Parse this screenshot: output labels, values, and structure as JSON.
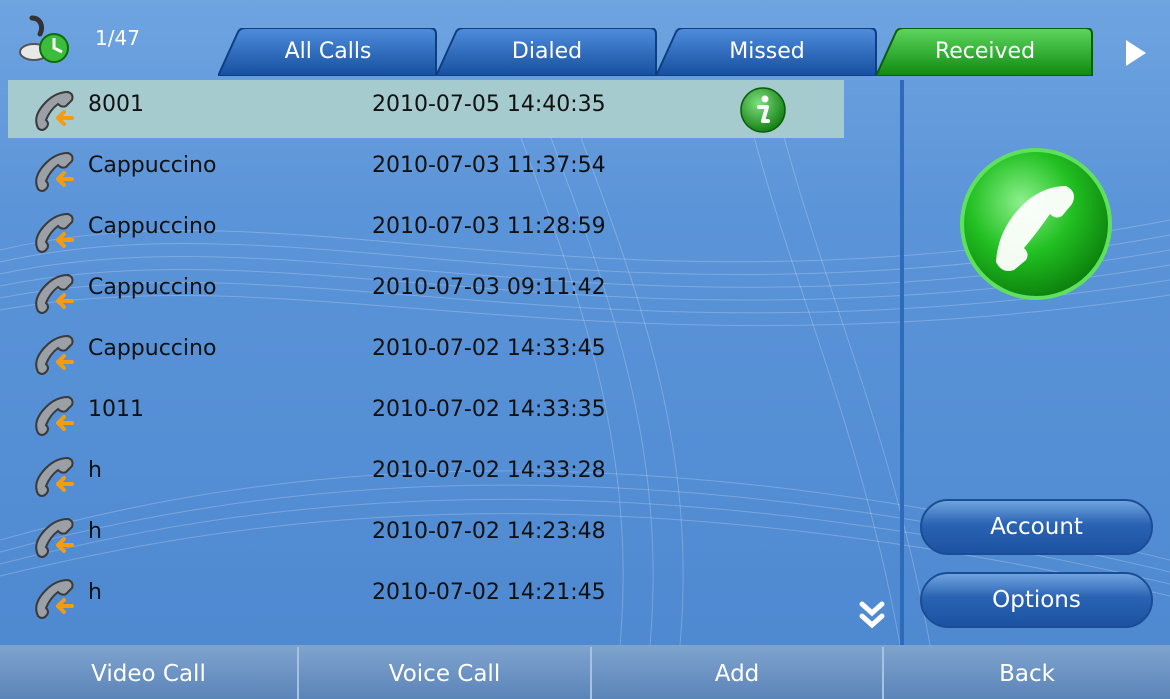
{
  "header": {
    "counter": "1/47",
    "tabs": [
      {
        "label": "All Calls",
        "active": false
      },
      {
        "label": "Dialed",
        "active": false
      },
      {
        "label": "Missed",
        "active": false
      },
      {
        "label": "Received",
        "active": true
      }
    ],
    "logo_icon": "phone-clock-icon",
    "next_icon": "triangle-right-icon"
  },
  "calls": [
    {
      "name": "8001",
      "time": "2010-07-05 14:40:35",
      "selected": true
    },
    {
      "name": "Cappuccino",
      "time": "2010-07-03 11:37:54"
    },
    {
      "name": "Cappuccino",
      "time": "2010-07-03 11:28:59"
    },
    {
      "name": "Cappuccino",
      "time": "2010-07-03 09:11:42"
    },
    {
      "name": "Cappuccino",
      "time": "2010-07-02 14:33:45"
    },
    {
      "name": "1011",
      "time": "2010-07-02 14:33:35"
    },
    {
      "name": "h",
      "time": "2010-07-02 14:33:28"
    },
    {
      "name": "h",
      "time": "2010-07-02 14:23:48"
    },
    {
      "name": "h",
      "time": "2010-07-02 14:21:45"
    }
  ],
  "row_icon": "received-call-icon",
  "info_icon": "info-icon",
  "right_panel": {
    "call_icon": "green-call-icon",
    "account_label": "Account",
    "options_label": "Options"
  },
  "bottom_bar": {
    "video_call": "Video Call",
    "voice_call": "Voice Call",
    "add": "Add",
    "back": "Back"
  },
  "colors": {
    "background": "#5b94d8",
    "tab_blue": "#1d5cb0",
    "tab_active": "#17a317",
    "selected_row": "#a6cbcf",
    "call_green": "#1fbf1f"
  }
}
